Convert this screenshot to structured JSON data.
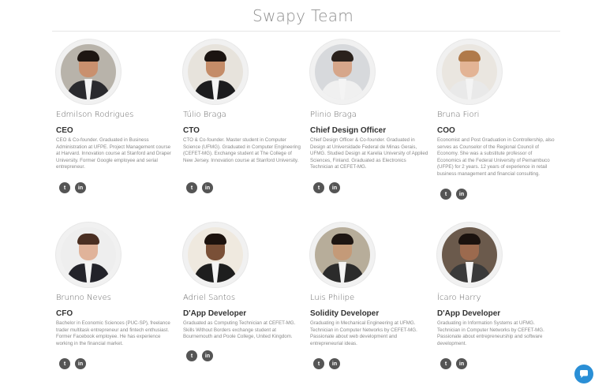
{
  "page": {
    "title": "Swapy Team"
  },
  "members": [
    {
      "name": "Edmilson Rodrigues",
      "role": "CEO",
      "bio": "CEO & Co-founder. Graduated in Business Administration at UFPE. Project Management course at Harvard. Innovation course at Stanford and Draper University. Former Google employee and serial entrepreneur.",
      "avatar": {
        "bg": "#b8b3aa",
        "skin": "#c9906e",
        "hair": "#1e1612",
        "suit": "#2a2a2e"
      },
      "social": {
        "twitter_icon": "twitter-icon",
        "linkedin_icon": "linkedin-icon"
      }
    },
    {
      "name": "Túlio Braga",
      "role": "CTO",
      "bio": "CTO & Co-founder. Master student in Computer Science (UFMG). Graduated in Computer Engineering (CEFET-MG). Exchange student at The College of New Jersey. Innovation course at Stanford University.",
      "avatar": {
        "bg": "#e7e3dc",
        "skin": "#c48c68",
        "hair": "#1b1411",
        "suit": "#1c1c1e"
      },
      "social": {
        "twitter_icon": "twitter-icon",
        "linkedin_icon": "linkedin-icon"
      }
    },
    {
      "name": "Plinio Braga",
      "role": "Chief Design Officer",
      "bio": "Chief Design Officer & Co-founder. Graduated in Design at Universidade Federal de Minas Gerais, UFMG. Studied Design at Karelia University of Applied Sciences, Finland. Graduated as Electronics Technician at CEFET-MG.",
      "avatar": {
        "bg": "#d7d9dc",
        "skin": "#d6a68a",
        "hair": "#2a211c",
        "suit": "#f0f0f0"
      },
      "social": {
        "twitter_icon": "twitter-icon",
        "linkedin_icon": "linkedin-icon"
      }
    },
    {
      "name": "Bruna Fiori",
      "role": "COO",
      "bio": "Economist and Post Graduation in Controllership, also serves as Counselor of the Regional Council of Economy. She was a substitute professor of Economics at the Federal University of Pernambuco (UFPE) for 2 years. 12 years of experience in retail business management and financial consulting.",
      "avatar": {
        "bg": "#eae6e0",
        "skin": "#e3b495",
        "hair": "#b07a4a",
        "suit": "#e9e9e9"
      },
      "social": {
        "twitter_icon": "twitter-icon",
        "linkedin_icon": "linkedin-icon"
      }
    },
    {
      "name": "Brunno Neves",
      "role": "CFO",
      "bio": "Bachelor in Economic Sciences (PUC-SP), freelance trader multitask entrepreneur and fintech enthusiast. Former Facebook employee. He has experience working in the financial market.",
      "avatar": {
        "bg": "#eeeeee",
        "skin": "#e0b39a",
        "hair": "#4a2f22",
        "suit": "#23232a"
      },
      "social": {
        "twitter_icon": "twitter-icon",
        "linkedin_icon": "linkedin-icon"
      }
    },
    {
      "name": "Adriel Santos",
      "role": "D'App Developer",
      "bio": "Graduated as Computing Technician at CEFET-MG. Skills Without Borders exchange student at Bournemouth and Poole College, United Kingdom.",
      "avatar": {
        "bg": "#efe9df",
        "skin": "#7a5037",
        "hair": "#1c120d",
        "suit": "#1e1e1e"
      },
      "social": {
        "twitter_icon": "twitter-icon",
        "linkedin_icon": "linkedin-icon"
      }
    },
    {
      "name": "Luis Philipe",
      "role": "Solidity Developer",
      "bio": "Graduating in Mechanical Engineering at UFMG. Technician in Computer Networks by CEFET-MG. Passionate about web development and entrepreneurial ideas.",
      "avatar": {
        "bg": "#b7ad9a",
        "skin": "#c49a78",
        "hair": "#1e1612",
        "suit": "#2b2b2b"
      },
      "social": {
        "twitter_icon": "twitter-icon",
        "linkedin_icon": "linkedin-icon"
      }
    },
    {
      "name": "Ícaro Harry",
      "role": "D'App Developer",
      "bio": "Graduating in Information Systems at UFMG. Technician in Computer Networks by CEFET-MG. Passionate about entrepreneurship and software development.",
      "avatar": {
        "bg": "#6b5a4c",
        "skin": "#9c6a4e",
        "hair": "#1b120e",
        "suit": "#3a3a3a"
      },
      "social": {
        "twitter_icon": "twitter-icon",
        "linkedin_icon": "linkedin-icon"
      }
    }
  ],
  "chat": {
    "icon": "chat-bubble-icon"
  },
  "colors": {
    "chat_button": "#2a8fd6",
    "social_icons": "#555555"
  }
}
